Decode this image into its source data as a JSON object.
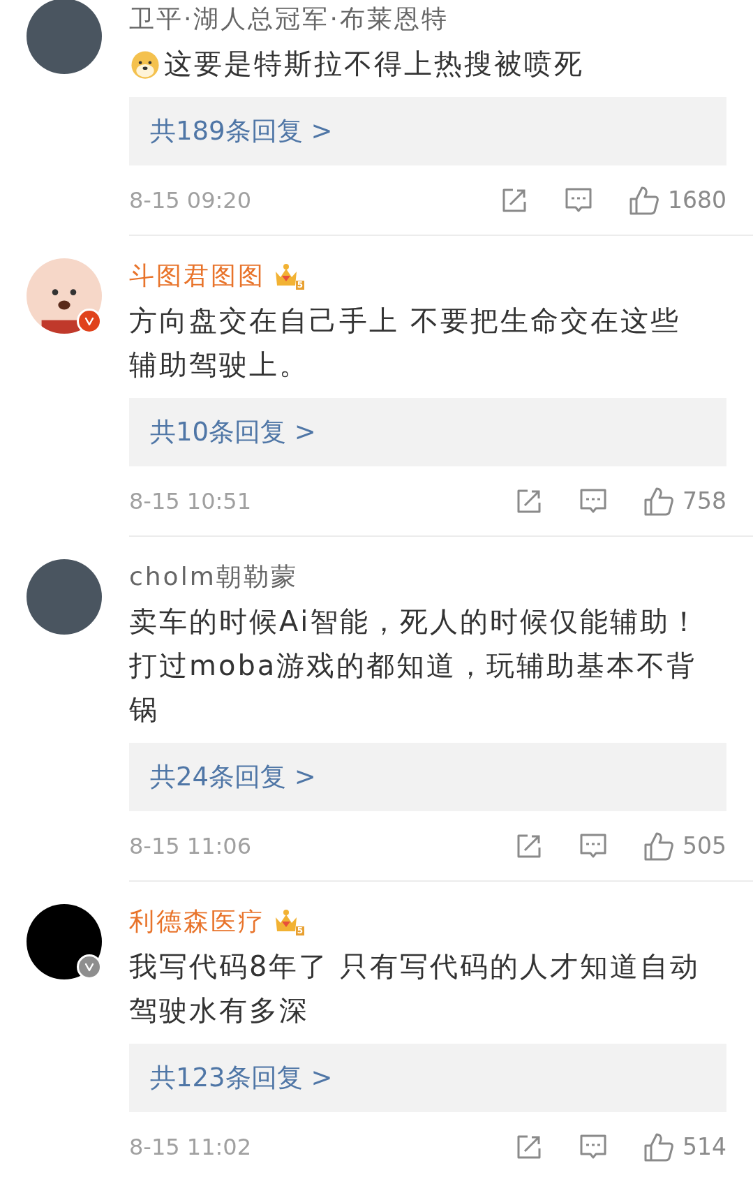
{
  "comments": [
    {
      "avatar": {
        "kind": "photo"
      },
      "name": "卫平·湖人总冠军·布莱恩特",
      "vip": false,
      "emoji": true,
      "lines": [
        "这要是特斯拉不得上热搜被喷死"
      ],
      "replies": "共189条回复 >",
      "time": "8-15 09:20",
      "likes": "1680"
    },
    {
      "avatar": {
        "kind": "cartoon"
      },
      "badge": {
        "color": "#e0421b"
      },
      "name": "斗图君图图",
      "vip": true,
      "vip_level": "5",
      "emoji": false,
      "lines": [
        "方向盘交在自己手上 不要把生命交在这些",
        "辅助驾驶上。"
      ],
      "replies": "共10条回复 >",
      "time": "8-15 10:51",
      "likes": "758"
    },
    {
      "avatar": {
        "kind": "photo"
      },
      "name": "cholm朝勒蒙",
      "vip": false,
      "emoji": false,
      "lines": [
        "卖车的时候Ai智能，死人的时候仅能辅助！",
        "打过moba游戏的都知道，玩辅助基本不背",
        "锅"
      ],
      "replies": "共24条回复 >",
      "time": "8-15 11:06",
      "likes": "505"
    },
    {
      "avatar": {
        "kind": "dark"
      },
      "badge": {
        "color": "#8e8e8e"
      },
      "name": "利德森医疗",
      "vip": true,
      "vip_level": "5",
      "emoji": false,
      "lines": [
        "我写代码8年了 只有写代码的人才知道自动",
        "驾驶水有多深"
      ],
      "replies": "共123条回复 >",
      "time": "8-15 11:02",
      "likes": "514"
    }
  ]
}
